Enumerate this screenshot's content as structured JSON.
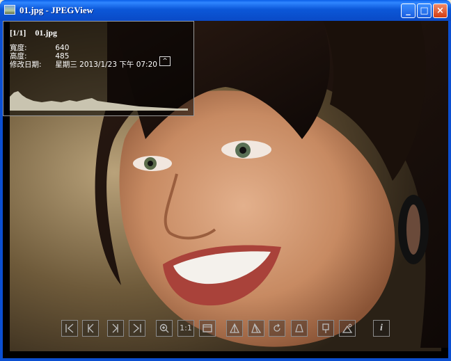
{
  "window": {
    "title": "01.jpg - JPEGView",
    "minimize_glyph": "_",
    "maximize_glyph": "□",
    "close_glyph": "×"
  },
  "info": {
    "index": "[1/1]",
    "filename": "01.jpg",
    "width_label": "寬度:",
    "width_value": "640",
    "height_label": "高度:",
    "height_value": "485",
    "date_label": "修改日期:",
    "date_value": "星期三 2013/1/23 下午 07:20",
    "collapse_glyph": "^"
  },
  "toolbar": {
    "zoom_1to1_label": "1:1",
    "info_label": "i",
    "buttons": [
      "first-image-icon",
      "previous-image-icon",
      "next-image-icon",
      "last-image-icon",
      "zoom-icon",
      "actual-size-icon",
      "fit-window-icon",
      "rotate-left-icon",
      "rotate-right-icon",
      "rotate-icon",
      "perspective-icon",
      "keep-params-icon",
      "landscape-mode-icon",
      "info-icon"
    ]
  },
  "colors": {
    "titlebar": "#0b57d8",
    "frame": "#0b4fd1",
    "close_button": "#d23d12",
    "histogram": "#c9c4b0"
  }
}
